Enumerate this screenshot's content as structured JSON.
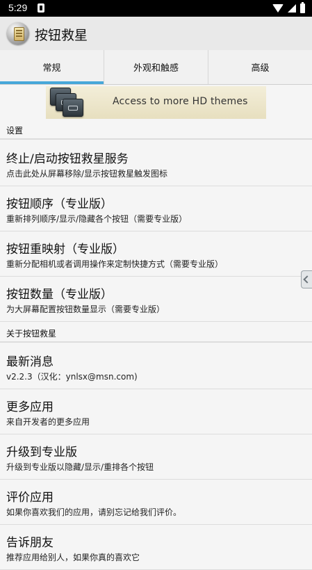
{
  "status": {
    "time": "5:29"
  },
  "app": {
    "title": "按钮救星"
  },
  "tabs": [
    {
      "label": "常规"
    },
    {
      "label": "外观和触感"
    },
    {
      "label": "高级"
    }
  ],
  "banner": {
    "text": "Access to more HD themes"
  },
  "sections": [
    {
      "title": "设置"
    },
    {
      "title": "关于按钮救星"
    }
  ],
  "items": [
    {
      "title": "终止/启动按钮救星服务",
      "subtitle": "点击此处从屏幕移除/显示按钮救星触发图标"
    },
    {
      "title": "按钮顺序（专业版）",
      "subtitle": "重新排列顺序/显示/隐藏各个按钮（需要专业版）"
    },
    {
      "title": "按钮重映射（专业版）",
      "subtitle": "重新分配相机或者调用操作来定制快捷方式（需要专业版）"
    },
    {
      "title": "按钮数量（专业版）",
      "subtitle": "为大屏幕配置按钮数量显示（需要专业版）"
    },
    {
      "title": "最新消息",
      "subtitle": "v2.2.3（汉化：ynlsx@msn.com)"
    },
    {
      "title": "更多应用",
      "subtitle": "来自开发者的更多应用"
    },
    {
      "title": "升级到专业版",
      "subtitle": "升级到专业版以隐藏/显示/重排各个按钮"
    },
    {
      "title": "评价应用",
      "subtitle": "如果你喜欢我们的应用，请别忘记给我们评价。"
    },
    {
      "title": "告诉朋友",
      "subtitle": "推荐应用给别人，如果你真的喜欢它"
    }
  ]
}
